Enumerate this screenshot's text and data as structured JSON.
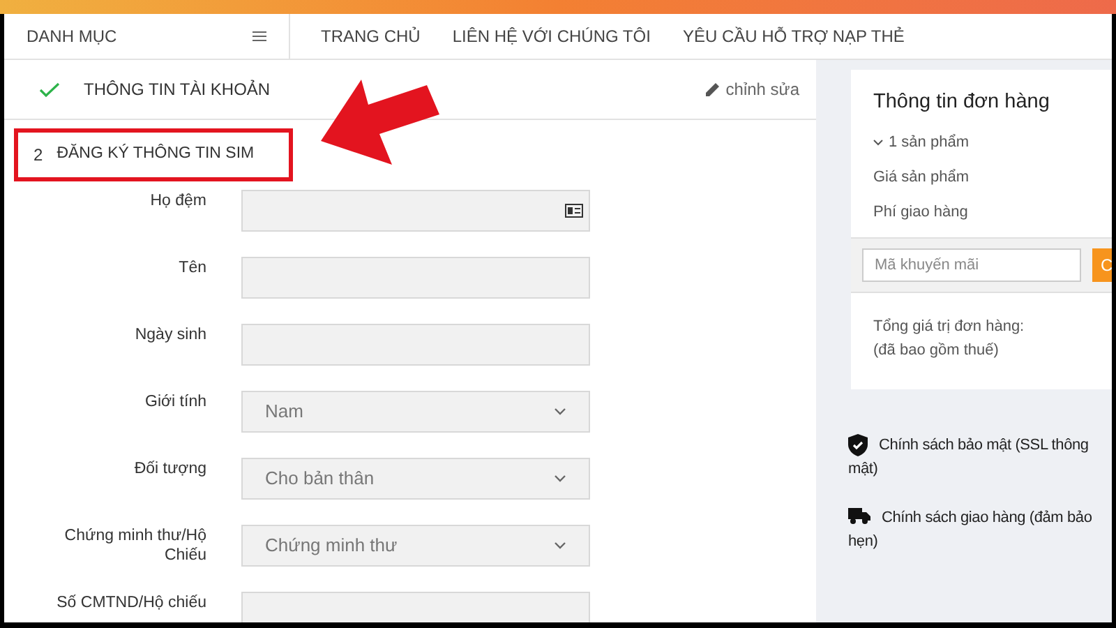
{
  "header": {
    "menu_title": "DANH MỤC",
    "nav": [
      "TRANG CHỦ",
      "LIÊN HỆ VỚI CHÚNG TÔI",
      "YÊU CẦU HỖ TRỢ NẠP THẺ"
    ]
  },
  "steps": [
    {
      "kind": "done",
      "title": "THÔNG TIN TÀI KHOẢN",
      "action": "chỉnh sửa",
      "highlighted": false
    },
    {
      "kind": "current",
      "number": "2",
      "title": "ĐĂNG KÝ THÔNG TIN SIM",
      "highlighted": true
    }
  ],
  "form": [
    {
      "label": "Họ đệm",
      "kind": "text",
      "card_icon": true
    },
    {
      "label": "Tên",
      "kind": "text",
      "card_icon": false
    },
    {
      "label": "Ngày sinh",
      "kind": "text",
      "card_icon": false
    },
    {
      "label": "Giới tính",
      "kind": "select",
      "value": "Nam"
    },
    {
      "label": "Đối tượng",
      "kind": "select",
      "value": "Cho bản thân"
    },
    {
      "label": "Chứng minh thư/Hộ Chiếu",
      "kind": "select",
      "value": "Chứng minh thư"
    },
    {
      "label": "Số CMTND/Hộ chiếu",
      "kind": "text",
      "card_icon": false
    }
  ],
  "order": {
    "title": "Thông tin đơn hàng",
    "items_toggle": "1 sản phẩm",
    "rows": [
      "Giá sản phẩm",
      "Phí giao hàng"
    ],
    "promo": {
      "placeholder": "Mã khuyến mãi",
      "button": "C"
    },
    "total_label": "Tổng giá trị đơn hàng:",
    "total_note": "(đã bao gồm thuế)"
  },
  "policies": [
    {
      "kind": "shield",
      "lines": [
        "Chính sách bảo mật (SSL thông",
        "mật)"
      ]
    },
    {
      "kind": "truck",
      "lines": [
        "Chính sách giao hàng (đảm bảo",
        "hẹn)"
      ]
    }
  ]
}
